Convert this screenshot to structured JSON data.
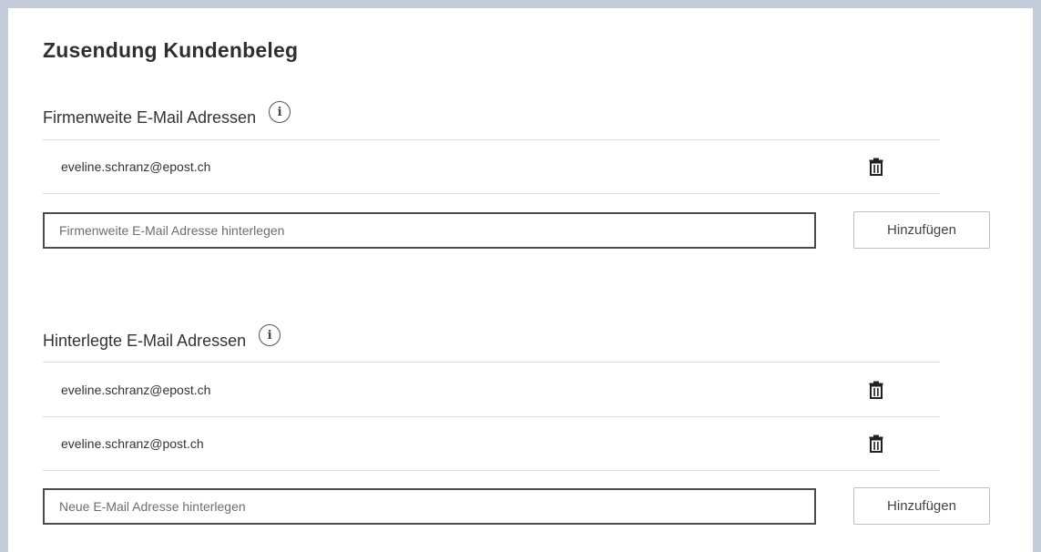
{
  "page": {
    "title": "Zusendung Kundenbeleg"
  },
  "company_emails": {
    "heading": "Firmenweite E-Mail Adressen",
    "info_icon": "i",
    "items": [
      {
        "email": "eveline.schranz@epost.ch"
      }
    ],
    "input_placeholder": "Firmenweite E-Mail Adresse hinterlegen",
    "add_label": "Hinzufügen"
  },
  "stored_emails": {
    "heading": "Hinterlegte E-Mail Adressen",
    "info_icon": "i",
    "items": [
      {
        "email": "eveline.schranz@epost.ch"
      },
      {
        "email": "eveline.schranz@post.ch"
      }
    ],
    "input_placeholder": "Neue E-Mail Adresse hinterlegen",
    "add_label": "Hinzufügen"
  },
  "icons": {
    "delete": "trash-icon",
    "info": "info-icon"
  },
  "colors": {
    "frame": "#c5cddb",
    "input_border": "#4b4b4b",
    "divider": "#dcdcdc"
  }
}
